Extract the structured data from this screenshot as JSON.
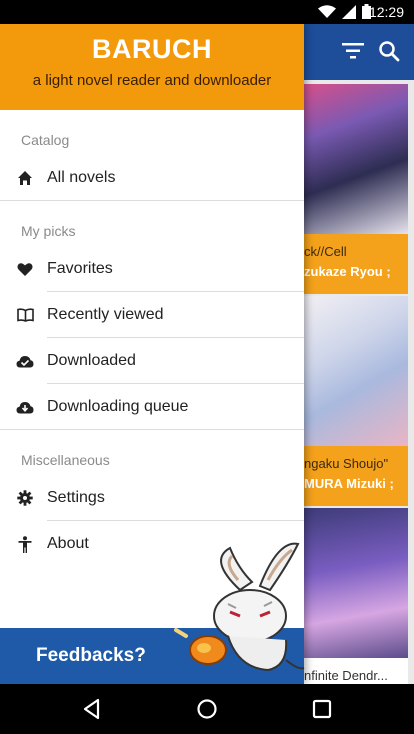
{
  "status_bar": {
    "time": "12:29",
    "icons": [
      "wifi-icon",
      "signal-icon",
      "battery-icon"
    ]
  },
  "drawer": {
    "title": "BARUCH",
    "subtitle": "a light novel reader and downloader",
    "sections": [
      {
        "label": "Catalog",
        "items": [
          {
            "label": "All novels",
            "icon": "home-icon"
          }
        ]
      },
      {
        "label": "My picks",
        "items": [
          {
            "label": "Favorites",
            "icon": "heart-icon"
          },
          {
            "label": "Recently viewed",
            "icon": "book-open-icon"
          },
          {
            "label": "Downloaded",
            "icon": "cloud-check-icon"
          },
          {
            "label": "Downloading queue",
            "icon": "cloud-download-icon"
          }
        ]
      },
      {
        "label": "Miscellaneous",
        "items": [
          {
            "label": "Settings",
            "icon": "gear-icon"
          },
          {
            "label": "About",
            "icon": "person-icon"
          }
        ]
      }
    ],
    "feedback_label": "Feedbacks?"
  },
  "background_app": {
    "cards": [
      {
        "caption_line1": "ck//Cell",
        "caption_line2": "zukaze Ryou ;"
      },
      {
        "caption_line1": "ngaku Shoujo\"",
        "caption_line2": "MURA Mizuki ;"
      },
      {
        "caption_line1": "nfinite Dendr..."
      }
    ]
  },
  "colors": {
    "header_orange": "#f39a0c",
    "feedback_blue": "#1e5aa8",
    "app_bar_blue": "#1e4e9a",
    "caption_orange": "#f4a21b"
  }
}
